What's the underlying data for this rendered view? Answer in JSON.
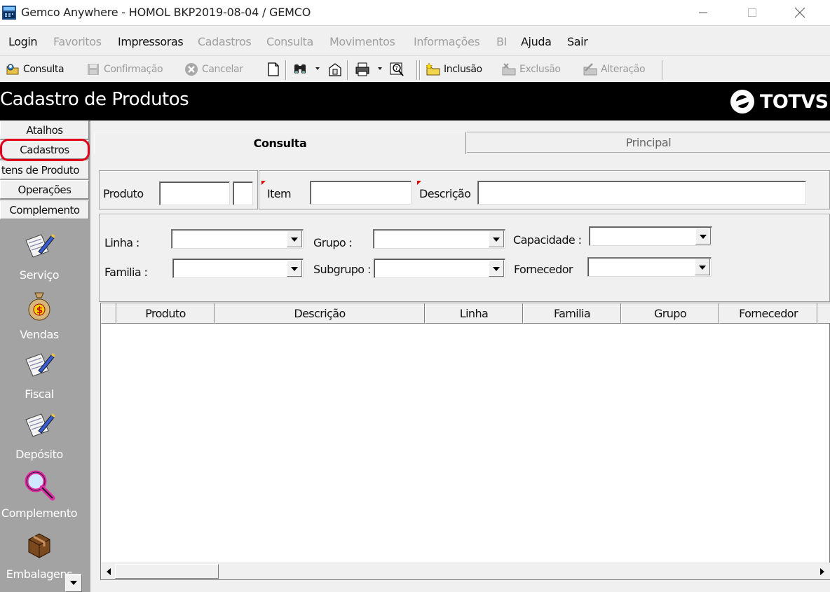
{
  "window": {
    "title": "Gemco Anywhere - HOMOL BKP2019-08-04 / GEMCO",
    "minimize_icon": "minimize-icon",
    "maximize_icon": "maximize-icon",
    "close_icon": "close-icon"
  },
  "menu": {
    "items": [
      {
        "label": "Login",
        "enabled": true
      },
      {
        "label": "Favoritos",
        "enabled": false
      },
      {
        "label": "Impressoras",
        "enabled": true
      },
      {
        "label": "Cadastros",
        "enabled": false
      },
      {
        "label": "Consulta",
        "enabled": false
      },
      {
        "label": "Movimentos",
        "enabled": false
      },
      {
        "label": "Informações",
        "enabled": false
      },
      {
        "label": "BI",
        "enabled": false
      },
      {
        "label": "Ajuda",
        "enabled": true
      },
      {
        "label": "Sair",
        "enabled": true
      }
    ]
  },
  "toolbar": {
    "consulta": "Consulta",
    "confirmacao": "Confirmação",
    "cancelar": "Cancelar",
    "inclusao": "Inclusão",
    "exclusao": "Exclusão",
    "alteracao": "Alteração",
    "icons": [
      "new-document-icon",
      "binoculars-icon",
      "export-icon",
      "printer-icon",
      "help-search-icon"
    ]
  },
  "header": {
    "title": "Cadastro de Produtos",
    "logo_text": "TOTVS"
  },
  "sidebar": {
    "tabs": [
      "Atalhos",
      "Cadastros",
      "Itens de Produto",
      "Operações",
      "Complemento"
    ],
    "items": [
      {
        "label": "Serviço",
        "icon": "document-pen-icon"
      },
      {
        "label": "Vendas",
        "icon": "money-bag-icon"
      },
      {
        "label": "Fiscal",
        "icon": "document-pen-icon"
      },
      {
        "label": "Depósito",
        "icon": "document-pen-icon"
      },
      {
        "label": "Complemento",
        "icon": "magnifier-icon"
      },
      {
        "label": "Embalagens",
        "icon": "package-icon"
      }
    ]
  },
  "tabs": {
    "consulta": "Consulta",
    "principal": "Principal"
  },
  "search": {
    "produto_label": "Produto",
    "item_label": "Item",
    "descricao_label": "Descrição",
    "produto_value": "",
    "produto_digit": "",
    "item_value": "",
    "descricao_value": ""
  },
  "filters": {
    "linha_label": "Linha :",
    "familia_label": "Familia :",
    "grupo_label": "Grupo :",
    "subgrupo_label": "Subgrupo :",
    "capacidade_label": "Capacidade :",
    "fornecedor_label": "Fornecedor",
    "linha_value": "",
    "familia_value": "",
    "grupo_value": "",
    "subgrupo_value": "",
    "capacidade_value": "",
    "fornecedor_value": ""
  },
  "grid": {
    "columns": [
      "Produto",
      "Descrição",
      "Linha",
      "Familia",
      "Grupo",
      "Fornecedor"
    ],
    "rows": []
  }
}
